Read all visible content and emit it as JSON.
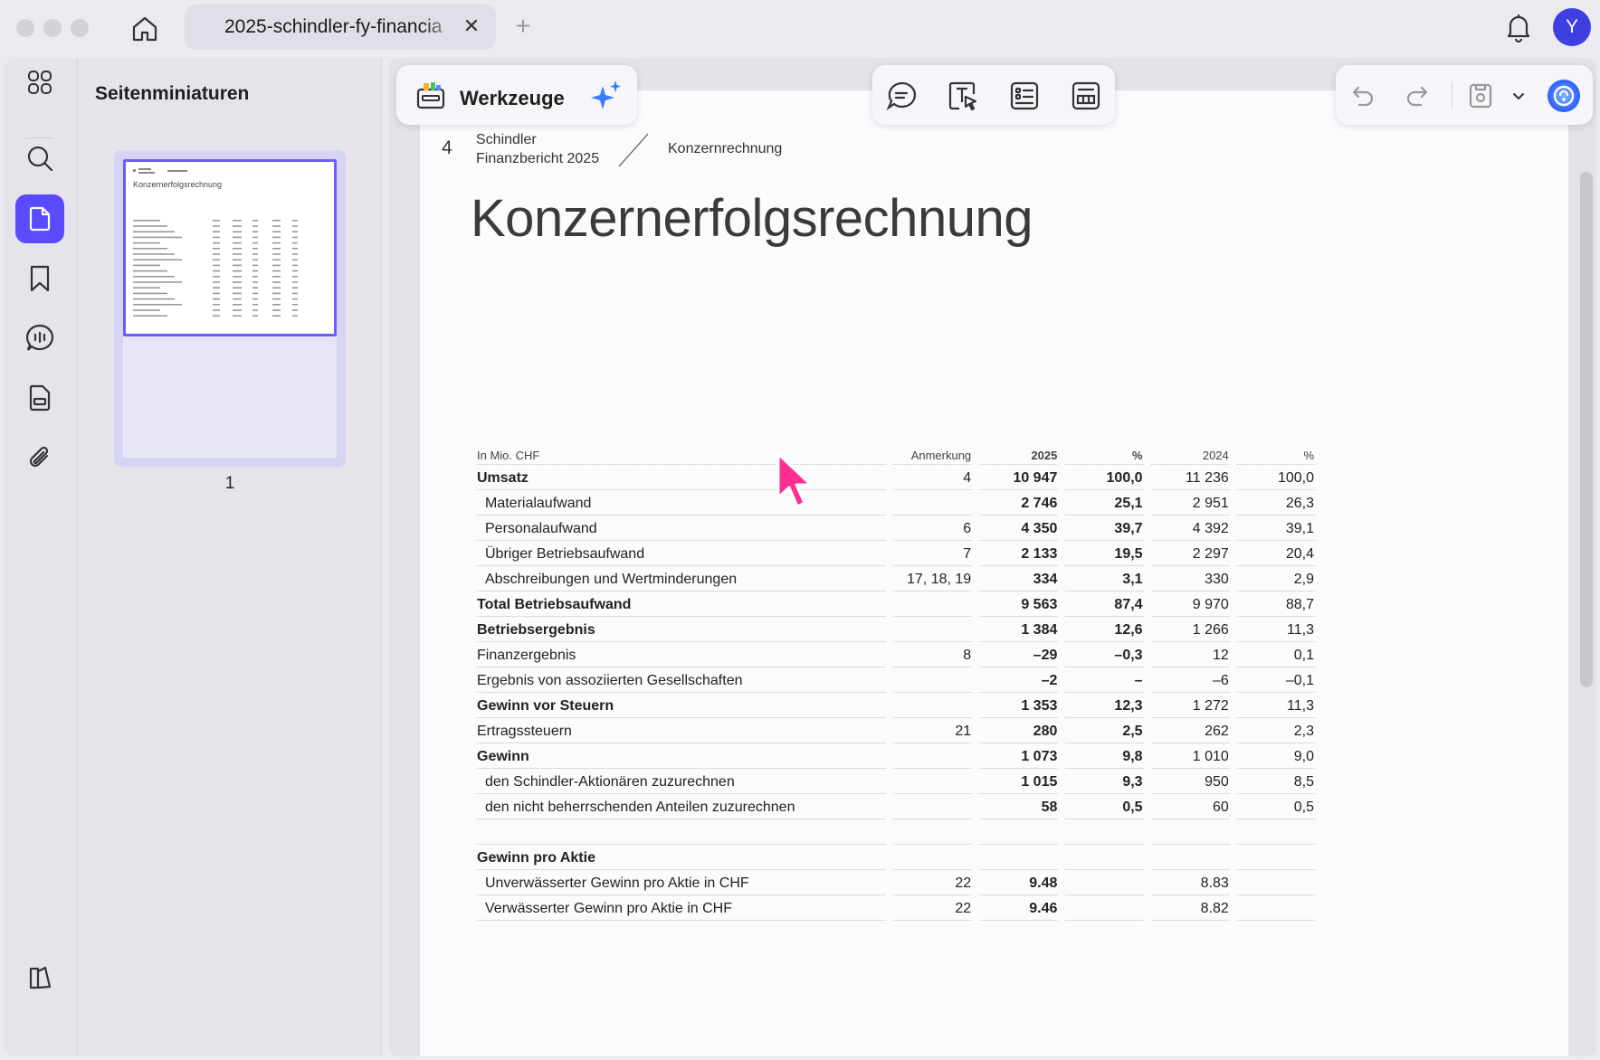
{
  "window": {
    "tab_title": "2025-schindler-fy-financia",
    "tab_close": "✕",
    "new_tab": "+",
    "avatar_initial": "Y"
  },
  "sidebar": {
    "rail_items": [
      {
        "name": "grid",
        "icon": "grid-icon"
      },
      {
        "name": "search",
        "icon": "search-icon"
      },
      {
        "name": "thumbnails",
        "icon": "page-icon",
        "active": true
      },
      {
        "name": "bookmarks",
        "icon": "bookmark-icon"
      },
      {
        "name": "comments",
        "icon": "comment-icon"
      },
      {
        "name": "forms",
        "icon": "form-icon"
      },
      {
        "name": "attachments",
        "icon": "paperclip-icon"
      }
    ],
    "panel_title": "Seitenminiaturen",
    "thumbnails": [
      {
        "page_number": "1",
        "title": "Konzernerfolgsrechnung"
      }
    ]
  },
  "toolbar": {
    "tools_label": "Werkzeuge",
    "icons": [
      "comment-tool-icon",
      "text-select-icon",
      "form-list-icon",
      "table-tool-icon"
    ],
    "right_icons": [
      "undo-icon",
      "redo-icon",
      "save-icon",
      "chevron-down-icon",
      "ai-assistant-icon"
    ]
  },
  "document": {
    "page_number": "4",
    "brand_line1": "Schindler",
    "brand_line2": "Finanzbericht 2025",
    "section": "Konzernrechnung",
    "title": "Konzernerfolgsrechnung",
    "table": {
      "headers": [
        "In Mio. CHF",
        "Anmerkung",
        "2025",
        "%",
        "2024",
        "%"
      ],
      "rows": [
        {
          "label": "Umsatz",
          "note": "4",
          "v2025": "10 947",
          "p2025": "100,0",
          "v2024": "11 236",
          "p2024": "100,0",
          "bold": true,
          "indent": false
        },
        {
          "label": "Materialaufwand",
          "note": "",
          "v2025": "2 746",
          "p2025": "25,1",
          "v2024": "2 951",
          "p2024": "26,3",
          "bold": false,
          "indent": true
        },
        {
          "label": "Personalaufwand",
          "note": "6",
          "v2025": "4 350",
          "p2025": "39,7",
          "v2024": "4 392",
          "p2024": "39,1",
          "bold": false,
          "indent": true
        },
        {
          "label": "Übriger Betriebsaufwand",
          "note": "7",
          "v2025": "2 133",
          "p2025": "19,5",
          "v2024": "2 297",
          "p2024": "20,4",
          "bold": false,
          "indent": true
        },
        {
          "label": "Abschreibungen und Wertminderungen",
          "note": "17, 18, 19",
          "v2025": "334",
          "p2025": "3,1",
          "v2024": "330",
          "p2024": "2,9",
          "bold": false,
          "indent": true
        },
        {
          "label": "Total Betriebsaufwand",
          "note": "",
          "v2025": "9 563",
          "p2025": "87,4",
          "v2024": "9 970",
          "p2024": "88,7",
          "bold": true,
          "indent": false
        },
        {
          "label": "Betriebsergebnis",
          "note": "",
          "v2025": "1 384",
          "p2025": "12,6",
          "v2024": "1 266",
          "p2024": "11,3",
          "bold": true,
          "indent": false
        },
        {
          "label": "Finanzergebnis",
          "note": "8",
          "v2025": "–29",
          "p2025": "–0,3",
          "v2024": "12",
          "p2024": "0,1",
          "bold": false,
          "indent": false
        },
        {
          "label": "Ergebnis von assoziierten Gesellschaften",
          "note": "",
          "v2025": "–2",
          "p2025": "–",
          "v2024": "–6",
          "p2024": "–0,1",
          "bold": false,
          "indent": false
        },
        {
          "label": "Gewinn vor Steuern",
          "note": "",
          "v2025": "1 353",
          "p2025": "12,3",
          "v2024": "1 272",
          "p2024": "11,3",
          "bold": true,
          "indent": false
        },
        {
          "label": "Ertragssteuern",
          "note": "21",
          "v2025": "280",
          "p2025": "2,5",
          "v2024": "262",
          "p2024": "2,3",
          "bold": false,
          "indent": false
        },
        {
          "label": "Gewinn",
          "note": "",
          "v2025": "1 073",
          "p2025": "9,8",
          "v2024": "1 010",
          "p2024": "9,0",
          "bold": true,
          "indent": false
        },
        {
          "label": "den Schindler-Aktionären zuzurechnen",
          "note": "",
          "v2025": "1 015",
          "p2025": "9,3",
          "v2024": "950",
          "p2024": "8,5",
          "bold": false,
          "indent": true
        },
        {
          "label": "den nicht beherrschenden Anteilen zuzurechnen",
          "note": "",
          "v2025": "58",
          "p2025": "0,5",
          "v2024": "60",
          "p2024": "0,5",
          "bold": false,
          "indent": true
        },
        {
          "label": "",
          "note": "",
          "v2025": "",
          "p2025": "",
          "v2024": "",
          "p2024": "",
          "bold": false,
          "indent": false,
          "spacer": true
        },
        {
          "label": "Gewinn pro Aktie",
          "note": "",
          "v2025": "",
          "p2025": "",
          "v2024": "",
          "p2024": "",
          "bold": true,
          "indent": false
        },
        {
          "label": "Unverwässerter Gewinn pro Aktie in CHF",
          "note": "22",
          "v2025": "9.48",
          "p2025": "",
          "v2024": "8.83",
          "p2024": "",
          "bold": false,
          "indent": true
        },
        {
          "label": "Verwässerter Gewinn pro Aktie in CHF",
          "note": "22",
          "v2025": "9.46",
          "p2025": "",
          "v2024": "8.82",
          "p2024": "",
          "bold": false,
          "indent": true
        }
      ]
    }
  },
  "colors": {
    "accent": "#5a4bff",
    "avatar": "#3d3fe0",
    "cursor": "#ff2e93"
  }
}
